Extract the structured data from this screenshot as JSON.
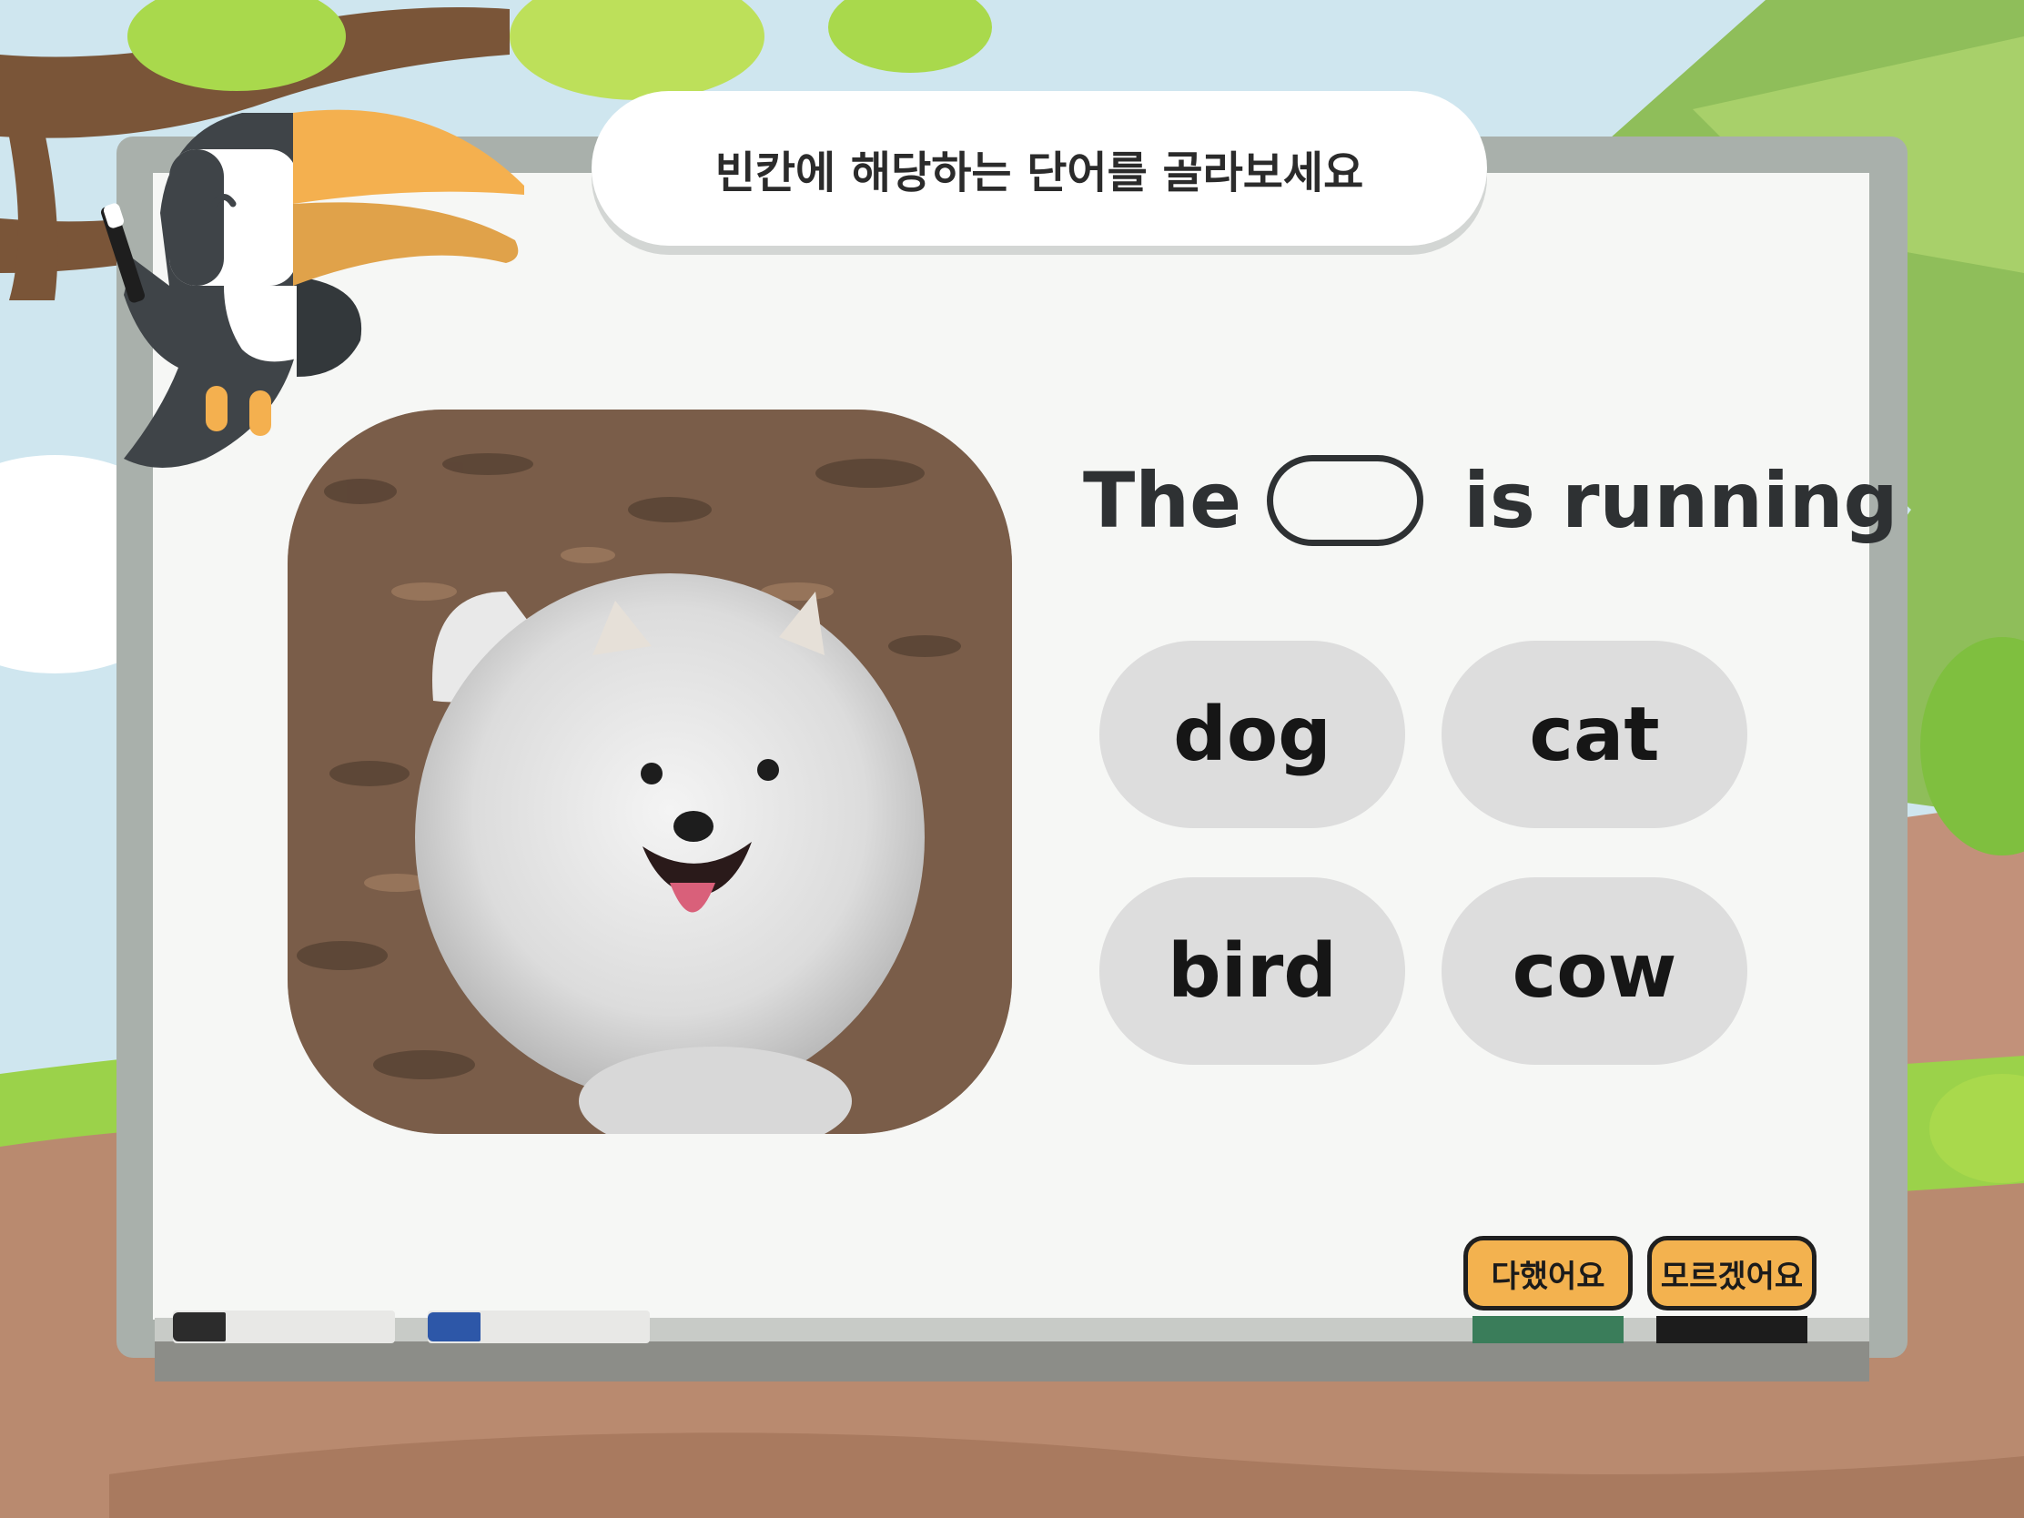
{
  "instruction": "빈칸에 해당하는 단어를 골라보세요",
  "sentence": {
    "before": "The",
    "after": "is running"
  },
  "choices": [
    "dog",
    "cat",
    "bird",
    "cow"
  ],
  "buttons": {
    "done": "다했어요",
    "dont_know": "모르겠어요"
  },
  "icons": {
    "mascot": "toucan-icon",
    "photo": "running-white-dog-photo"
  },
  "colors": {
    "accent": "#f3b24f",
    "board": "#f6f7f5",
    "choice_bg": "#dddddd",
    "frame": "#a9b0ab"
  }
}
